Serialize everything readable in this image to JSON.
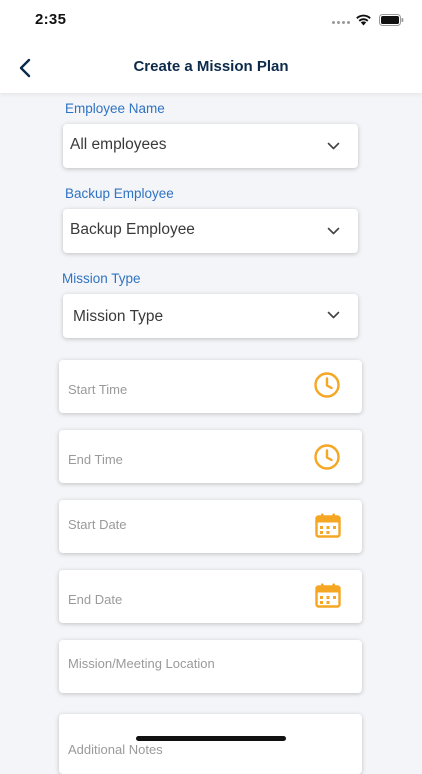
{
  "status_bar": {
    "time": "2:35"
  },
  "nav": {
    "title": "Create a Mission Plan",
    "back_icon": "chevron-left-icon"
  },
  "form": {
    "employee_name": {
      "label": "Employee Name",
      "value": "All employees"
    },
    "backup_employee": {
      "label": "Backup Employee",
      "value": "Backup Employee"
    },
    "mission_type": {
      "label": "Mission Type",
      "value": "Mission Type"
    },
    "start_time": {
      "placeholder": "Start Time",
      "icon": "clock-icon"
    },
    "end_time": {
      "placeholder": "End Time",
      "icon": "clock-icon"
    },
    "start_date": {
      "placeholder": "Start Date",
      "icon": "calendar-icon"
    },
    "end_date": {
      "placeholder": "End Date",
      "icon": "calendar-icon"
    },
    "location": {
      "placeholder": "Mission/Meeting Location"
    },
    "notes": {
      "placeholder": "Additional Notes"
    }
  },
  "colors": {
    "accent_orange": "#f5a623",
    "label_blue": "#2f73c2",
    "title_navy": "#0c2a4a"
  }
}
